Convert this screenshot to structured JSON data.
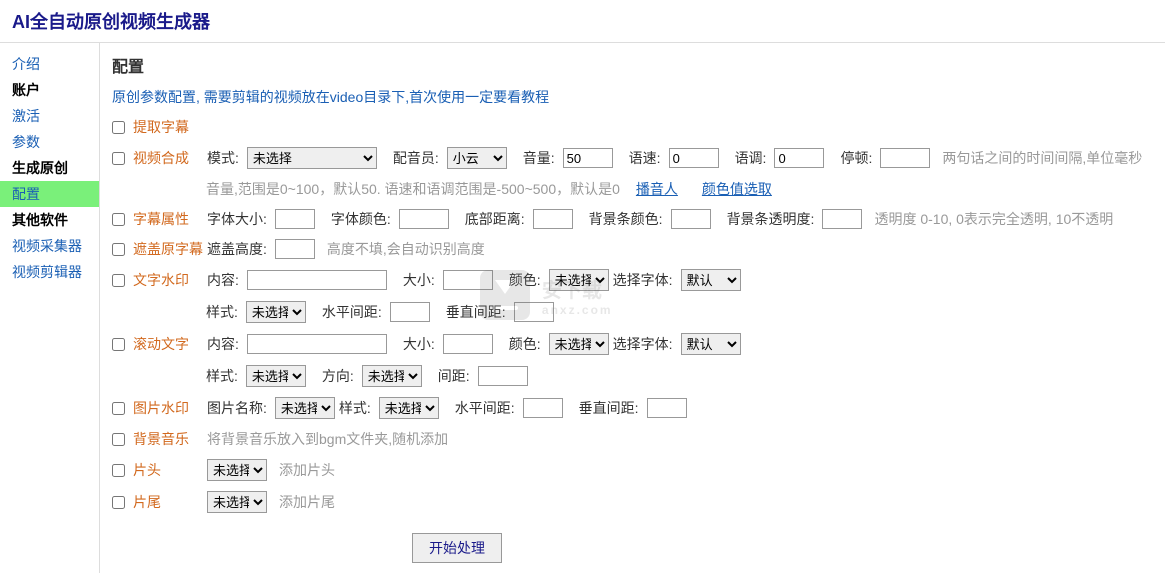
{
  "header": {
    "title": "AI全自动原创视频生成器"
  },
  "sidebar": {
    "items": [
      {
        "label": "介绍",
        "type": "link"
      },
      {
        "label": "账户",
        "type": "heading"
      },
      {
        "label": "激活",
        "type": "link"
      },
      {
        "label": "参数",
        "type": "link"
      },
      {
        "label": "生成原创",
        "type": "heading"
      },
      {
        "label": "配置",
        "type": "link",
        "active": true
      },
      {
        "label": "其他软件",
        "type": "heading"
      },
      {
        "label": "视频采集器",
        "type": "link"
      },
      {
        "label": "视频剪辑器",
        "type": "link"
      }
    ]
  },
  "main": {
    "title": "配置",
    "subtitle": "原创参数配置, 需要剪辑的视频放在video目录下,首次使用一定要看教程",
    "extractSubtitle": {
      "label": "提取字幕"
    },
    "videoSynth": {
      "label": "视频合成",
      "modeLabel": "模式:",
      "modeValue": "未选择",
      "voiceLabel": "配音员:",
      "voiceValue": "小云",
      "volumeLabel": "音量:",
      "volumeValue": "50",
      "speedLabel": "语速:",
      "speedValue": "0",
      "toneLabel": "语调:",
      "toneValue": "0",
      "pauseLabel": "停顿:",
      "pauseValue": "",
      "pauseHint": "两句话之间的时间间隔,单位毫秒",
      "rangeHint": "音量,范围是0~100，默认50. 语速和语调范围是-500~500，默认是0",
      "broadcasterLink": "播音人",
      "colorLink": "颜色值选取"
    },
    "subtitleAttr": {
      "label": "字幕属性",
      "fontSizeLabel": "字体大小:",
      "fontColorLabel": "字体颜色:",
      "bottomLabel": "底部距离:",
      "bgColorLabel": "背景条颜色:",
      "bgOpacityLabel": "背景条透明度:",
      "opacityHint": "透明度 0-10, 0表示完全透明, 10不透明"
    },
    "coverSubtitle": {
      "label": "遮盖原字幕",
      "heightLabel": "遮盖高度:",
      "heightHint": "高度不填,会自动识别高度"
    },
    "textWatermark": {
      "label": "文字水印",
      "contentLabel": "内容:",
      "sizeLabel": "大小:",
      "colorLabel": "颜色:",
      "colorValue": "未选择",
      "fontLabel": "选择字体:",
      "fontValue": "默认",
      "styleLabel": "样式:",
      "styleValue": "未选择",
      "hgapLabel": "水平间距:",
      "vgapLabel": "垂直间距:"
    },
    "scrollText": {
      "label": "滚动文字",
      "contentLabel": "内容:",
      "sizeLabel": "大小:",
      "colorLabel": "颜色:",
      "colorValue": "未选择",
      "fontLabel": "选择字体:",
      "fontValue": "默认",
      "styleLabel": "样式:",
      "styleValue": "未选择",
      "directionLabel": "方向:",
      "directionValue": "未选择",
      "gapLabel": "间距:"
    },
    "imageWatermark": {
      "label": "图片水印",
      "nameLabel": "图片名称:",
      "nameValue": "未选择",
      "styleLabel": "样式:",
      "styleValue": "未选择",
      "hgapLabel": "水平间距:",
      "vgapLabel": "垂直间距:"
    },
    "bgMusic": {
      "label": "背景音乐",
      "hint": "将背景音乐放入到bgm文件夹,随机添加"
    },
    "head": {
      "label": "片头",
      "value": "未选择",
      "hint": "添加片头"
    },
    "tail": {
      "label": "片尾",
      "value": "未选择",
      "hint": "添加片尾"
    },
    "submit": {
      "label": "开始处理"
    }
  },
  "watermark": {
    "text": "安下载",
    "sub": "anxz.com"
  }
}
